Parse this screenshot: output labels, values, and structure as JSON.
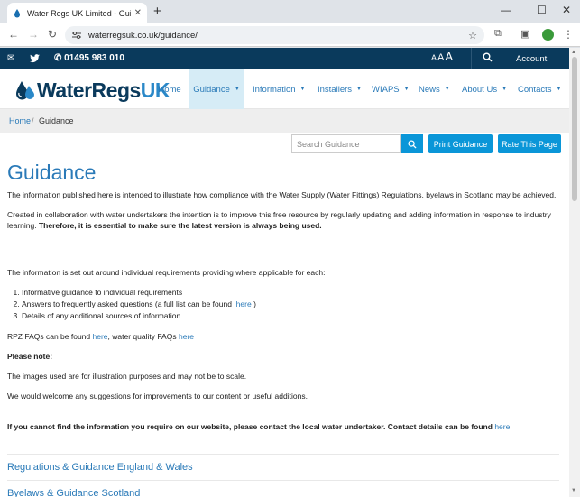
{
  "browser": {
    "tab_title": "Water Regs UK Limited - Guida",
    "url": "waterregsuk.co.uk/guidance/"
  },
  "topbar": {
    "phone": "01495 983 010",
    "text_size_a1": "A",
    "text_size_a2": "A",
    "text_size_a3": "A",
    "account": "Account"
  },
  "logo": {
    "main": "WaterRegs",
    "accent": "UK"
  },
  "nav": {
    "items": [
      {
        "label": "Home"
      },
      {
        "label": "Guidance"
      },
      {
        "label": "Information"
      },
      {
        "label": "Installers"
      },
      {
        "label": "WIAPS"
      },
      {
        "label": "News"
      },
      {
        "label": "About Us"
      },
      {
        "label": "Contacts"
      }
    ]
  },
  "breadcrumb": {
    "home": "Home",
    "separator": "/",
    "current": "Guidance"
  },
  "search": {
    "placeholder": "Search Guidance"
  },
  "buttons": {
    "print": "Print Guidance",
    "rate": "Rate This Page"
  },
  "content": {
    "title": "Guidance",
    "intro": "The information published here is intended to illustrate how compliance with the Water Supply (Water Fittings) Regulations, byelaws in Scotland may be achieved.",
    "collab": "Created in collaboration with water undertakers the intention is to improve this free resource by regularly updating and adding information in response to industry learning.",
    "collab_bold": "Therefore, it is essential to make sure the latest version is always being used.",
    "set_out": "The information is set out around individual requirements providing where applicable for each:",
    "list_1": "Informative guidance to individual requirements",
    "list_2_pre": "Answers to frequently asked questions (a full list can be found",
    "list_2_link": "here",
    "list_2_post": ")",
    "list_3": "Details of any additional sources of information",
    "rpz_pre": "RPZ FAQs can be found",
    "rpz_link": "here",
    "wq_pre": ", water quality FAQs",
    "wq_link": "here",
    "please_note": "Please note:",
    "images_note": "The images used are for illustration purposes and may not be to scale.",
    "suggestions": "We would welcome any suggestions for improvements to our content or useful additions.",
    "contact_bold": "If you cannot find the information you require on our website, please contact the local water undertaker. Contact details can be found",
    "contact_link": "here",
    "contact_end": ".",
    "section_1": "Regulations & Guidance England & Wales",
    "section_2": "Byelaws & Guidance Scotland"
  },
  "colors": {
    "brand_navy": "#0a3a5c",
    "link_blue": "#2a7ab8",
    "button_blue": "#0a96d8",
    "active_nav_bg": "#d6ecf6"
  }
}
